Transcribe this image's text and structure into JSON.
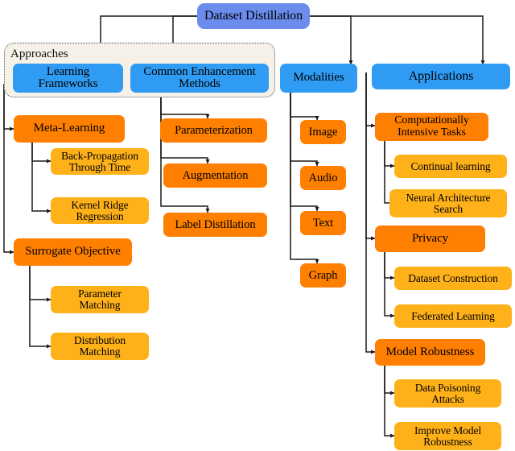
{
  "figure": {
    "title": "Dataset Distillation taxonomy tree",
    "background": "#ffffff"
  },
  "colors": {
    "root_blue": "#6b8ced",
    "level1_blue": "#2f9bf2",
    "orange_dark": "#ff7f00",
    "orange_light": "#ffb11a",
    "group_fill": "#f5f1e8",
    "group_border": "#555555",
    "edge": "#1a1a1a",
    "text": "#000000"
  },
  "root": {
    "label": "Dataset Distillation"
  },
  "group": {
    "label": "Approaches"
  },
  "branches": [
    {
      "id": "learning-frameworks",
      "label": "Learning\nFrameworks",
      "label_line1": "Learning",
      "label_line2": "Frameworks",
      "children": [
        {
          "id": "meta-learning",
          "label": "Meta-Learning",
          "children": [
            {
              "id": "back-propagation-through-time",
              "label": "Back-Propagation\nThrough Time"
            },
            {
              "id": "kernel-ridge-regression",
              "label": "Kernel Ridge\nRegression"
            }
          ]
        },
        {
          "id": "surrogate-objective",
          "label": "Surrogate Objective",
          "children": [
            {
              "id": "parameter-matching",
              "label": "Parameter\nMatching"
            },
            {
              "id": "distribution-matching",
              "label": "Distribution\nMatching"
            }
          ]
        }
      ]
    },
    {
      "id": "common-enhancement-methods",
      "label": "Common Enhancement\nMethods",
      "label_line1": "Common Enhancement",
      "label_line2": "Methods",
      "children": [
        {
          "id": "parameterization",
          "label": "Parameterization"
        },
        {
          "id": "augmentation",
          "label": "Augmentation"
        },
        {
          "id": "label-distillation",
          "label": "Label Distillation"
        }
      ]
    },
    {
      "id": "modalities",
      "label": "Modalities",
      "children": [
        {
          "id": "image",
          "label": "Image"
        },
        {
          "id": "audio",
          "label": "Audio"
        },
        {
          "id": "text",
          "label": "Text"
        },
        {
          "id": "graph",
          "label": "Graph"
        }
      ]
    },
    {
      "id": "applications",
      "label": "Applications",
      "children": [
        {
          "id": "computationally-intensive-tasks",
          "label": "Computationally\nIntensive Tasks",
          "children": [
            {
              "id": "continual-learning",
              "label": "Continual learning"
            },
            {
              "id": "neural-architecture-search",
              "label": "Neural Architecture\nSearch"
            }
          ]
        },
        {
          "id": "privacy",
          "label": "Privacy",
          "children": [
            {
              "id": "dataset-construction",
              "label": "Dataset Construction"
            },
            {
              "id": "federated-learning",
              "label": "Federated Learning"
            }
          ]
        },
        {
          "id": "model-robustness",
          "label": "Model Robustness",
          "children": [
            {
              "id": "data-poisoning-attacks",
              "label": "Data Poisoning\nAttacks"
            },
            {
              "id": "improve-model-robustness",
              "label": "Improve Model\nRobustness"
            }
          ]
        }
      ]
    }
  ],
  "nodes": {
    "root": {
      "text": "Dataset Distillation"
    },
    "learning_frameworks_l1": {
      "text": "Learning"
    },
    "learning_frameworks_l2": {
      "text": "Frameworks"
    },
    "common_enhancement_l1": {
      "text": "Common Enhancement"
    },
    "common_enhancement_l2": {
      "text": "Methods"
    },
    "modalities": {
      "text": "Modalities"
    },
    "applications": {
      "text": "Applications"
    },
    "approaches_group": {
      "text": "Approaches"
    },
    "meta_learning": {
      "text": "Meta-Learning"
    },
    "bptt_l1": {
      "text": "Back-Propagation"
    },
    "bptt_l2": {
      "text": "Through Time"
    },
    "krr_l1": {
      "text": "Kernel Ridge"
    },
    "krr_l2": {
      "text": "Regression"
    },
    "surrogate_objective": {
      "text": "Surrogate Objective"
    },
    "parameter_matching_l1": {
      "text": "Parameter"
    },
    "parameter_matching_l2": {
      "text": "Matching"
    },
    "distribution_matching_l1": {
      "text": "Distribution"
    },
    "distribution_matching_l2": {
      "text": "Matching"
    },
    "parameterization": {
      "text": "Parameterization"
    },
    "augmentation": {
      "text": "Augmentation"
    },
    "label_distillation": {
      "text": "Label Distillation"
    },
    "image": {
      "text": "Image"
    },
    "audio": {
      "text": "Audio"
    },
    "text": {
      "text": "Text"
    },
    "graph": {
      "text": "Graph"
    },
    "cit_l1": {
      "text": "Computationally"
    },
    "cit_l2": {
      "text": "Intensive Tasks"
    },
    "continual_learning": {
      "text": "Continual learning"
    },
    "nas_l1": {
      "text": "Neural Architecture"
    },
    "nas_l2": {
      "text": "Search"
    },
    "privacy": {
      "text": "Privacy"
    },
    "dataset_construction": {
      "text": "Dataset Construction"
    },
    "federated_learning": {
      "text": "Federated Learning"
    },
    "model_robustness": {
      "text": "Model Robustness"
    },
    "dpa_l1": {
      "text": "Data Poisoning"
    },
    "dpa_l2": {
      "text": "Attacks"
    },
    "imr_l1": {
      "text": "Improve Model"
    },
    "imr_l2": {
      "text": "Robustness"
    }
  }
}
